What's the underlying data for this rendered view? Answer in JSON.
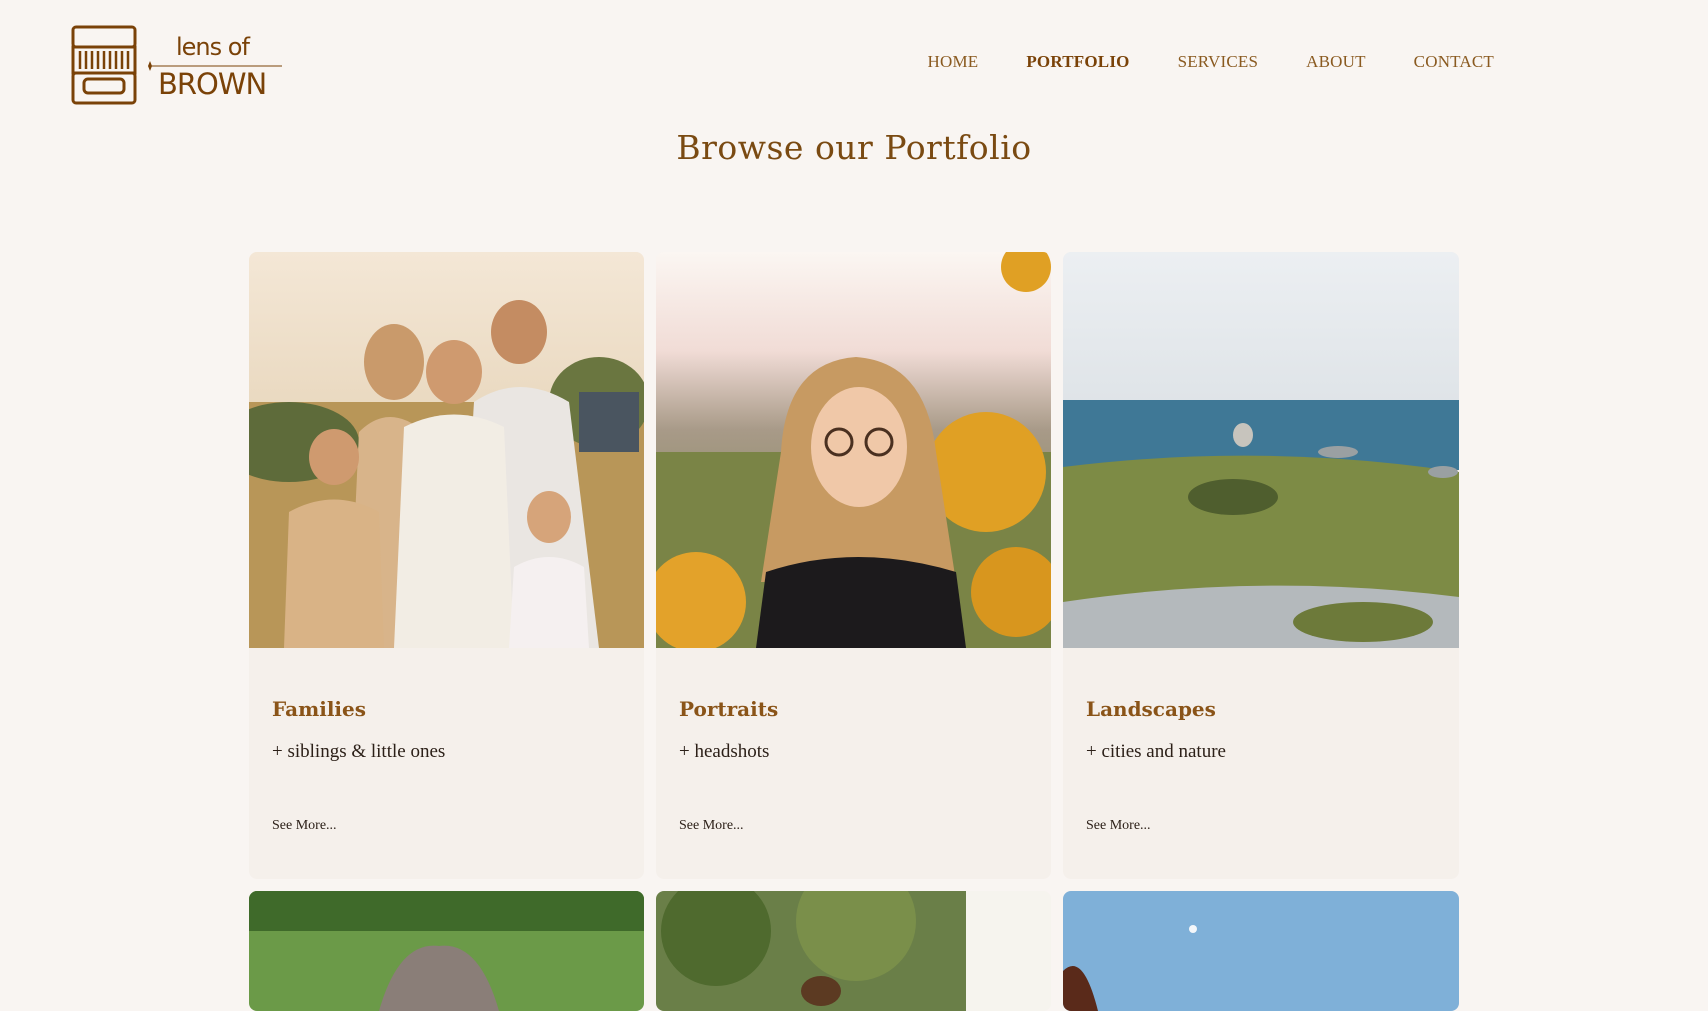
{
  "brand": {
    "line1": "lens of",
    "line2": "BROWN",
    "logo_icon": "camera-lens-icon",
    "color": "#7a4208"
  },
  "nav": {
    "items": [
      {
        "label": "HOME",
        "active": false
      },
      {
        "label": "PORTFOLIO",
        "active": true
      },
      {
        "label": "SERVICES",
        "active": false
      },
      {
        "label": "ABOUT",
        "active": false
      },
      {
        "label": "CONTACT",
        "active": false
      }
    ]
  },
  "page": {
    "title": "Browse our Portfolio"
  },
  "cards": [
    {
      "title": "Families",
      "subtitle": "+ siblings & little ones",
      "link": "See More..."
    },
    {
      "title": "Portraits",
      "subtitle": "+ headshots",
      "link": "See More..."
    },
    {
      "title": "Landscapes",
      "subtitle": "+ cities and nature",
      "link": "See More..."
    }
  ],
  "colors": {
    "background": "#f9f5f2",
    "card": "#f5f0eb",
    "accent": "#8a5418",
    "text": "#2c2018"
  }
}
